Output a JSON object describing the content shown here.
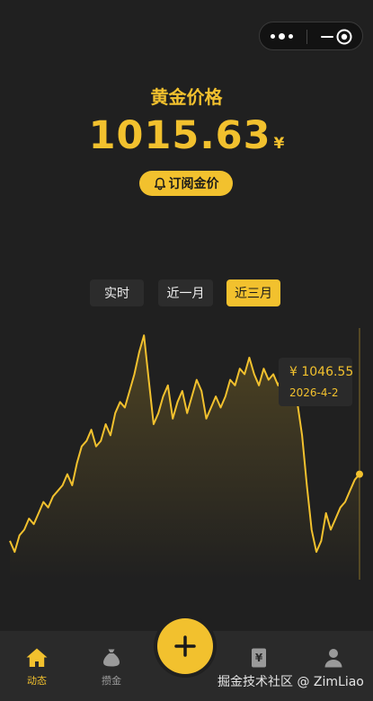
{
  "header": {
    "title": "黄金价格",
    "price": "1015.63",
    "currency": "¥"
  },
  "subscribe": {
    "label": "订阅金价"
  },
  "tabs": [
    {
      "label": "实时"
    },
    {
      "label": "近一月"
    },
    {
      "label": "近三月"
    }
  ],
  "active_tab": 2,
  "tooltip": {
    "price": "¥ 1046.55",
    "date": "2026-4-2"
  },
  "chart_data": {
    "type": "line",
    "title": "",
    "xlabel": "",
    "ylabel": "",
    "color": "#f2c12e",
    "ylim": [
      1005,
      1050
    ],
    "series": [
      {
        "values": [
          1012,
          1010,
          1013,
          1014,
          1016,
          1015,
          1017,
          1019,
          1018,
          1020,
          1021,
          1022,
          1024,
          1022,
          1026,
          1029,
          1030,
          1032,
          1029,
          1030,
          1033,
          1031,
          1035,
          1037,
          1036,
          1039,
          1042,
          1046,
          1049,
          1041,
          1033,
          1035,
          1038,
          1040,
          1034,
          1037,
          1039,
          1035,
          1038,
          1041,
          1039,
          1034,
          1036,
          1038,
          1036,
          1038,
          1041,
          1040,
          1043,
          1042,
          1045,
          1042,
          1040,
          1043,
          1041,
          1042,
          1040,
          1042,
          1039,
          1038,
          1037,
          1031,
          1022,
          1014,
          1010,
          1012,
          1017,
          1014,
          1016,
          1018,
          1019,
          1021,
          1023,
          1024
        ]
      }
    ]
  },
  "tabbar": {
    "items": [
      {
        "label": "动态"
      },
      {
        "label": "攒金"
      },
      {
        "label": ""
      },
      {
        "label": ""
      },
      {
        "label": ""
      }
    ]
  },
  "watermark": "掘金技术社区 @ ZimLiao",
  "colors": {
    "accent": "#f2c12e",
    "background": "#202020",
    "tabbar": "#2a2a2a"
  }
}
